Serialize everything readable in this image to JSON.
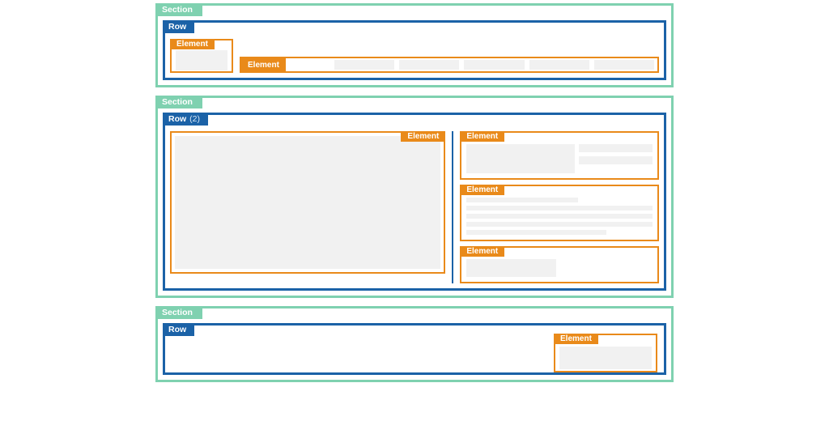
{
  "labels": {
    "section": "Section",
    "row": "Row",
    "element": "Element"
  },
  "sections": [
    {
      "row": {
        "count": null,
        "elements": [
          {
            "label_pos": "tl",
            "kind": "logo-placeholder"
          },
          {
            "label_pos": "inline-left",
            "kind": "nav-bar",
            "nav_items": 5
          }
        ]
      }
    },
    {
      "row": {
        "count": 2,
        "columns": [
          {
            "elements": [
              {
                "label_pos": "tr",
                "kind": "hero-image"
              }
            ]
          },
          {
            "elements": [
              {
                "label_pos": "tl",
                "kind": "heading-block"
              },
              {
                "label_pos": "tl",
                "kind": "text-lines"
              },
              {
                "label_pos": "tl",
                "kind": "cta-block"
              }
            ]
          }
        ]
      }
    },
    {
      "row": {
        "count": null,
        "elements": [
          {
            "label_pos": "tl",
            "kind": "footer-widget"
          }
        ]
      }
    }
  ]
}
